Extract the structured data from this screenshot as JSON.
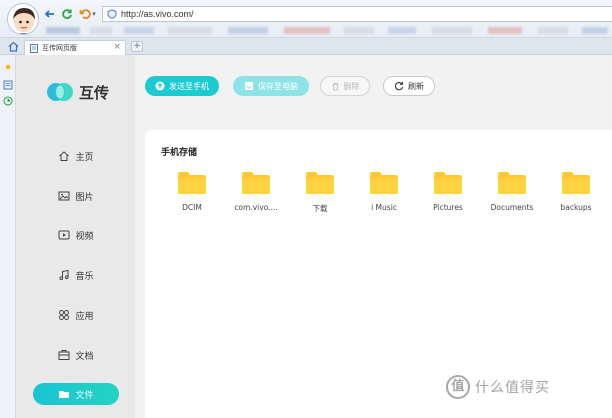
{
  "browser": {
    "url": "http://as.vivo.com/",
    "tab_title": "互传网页版",
    "tab_close": "×",
    "new_tab": "+"
  },
  "app": {
    "logo_text": "互传",
    "nav": [
      {
        "label": "主页",
        "icon": "home-icon"
      },
      {
        "label": "图片",
        "icon": "image-icon"
      },
      {
        "label": "视频",
        "icon": "video-icon"
      },
      {
        "label": "音乐",
        "icon": "music-icon"
      },
      {
        "label": "应用",
        "icon": "apps-icon"
      },
      {
        "label": "文档",
        "icon": "document-icon"
      },
      {
        "label": "文件",
        "icon": "folder-icon",
        "active": true
      }
    ],
    "toolbar": {
      "send_label": "发送至手机",
      "save_label": "保存至电脑",
      "delete_label": "删除",
      "refresh_label": "刷新"
    },
    "storage": {
      "title": "手机存储",
      "folders": [
        "DCIM",
        "com.vivo....",
        "下载",
        "i Music",
        "Pictures",
        "Documents",
        "backups"
      ]
    },
    "colors": {
      "accent": "#1ccad0",
      "accent_light": "#8fe3e6",
      "folder": "#ffc82c",
      "sidebar_bg": "#e9e9e9"
    }
  },
  "watermark": {
    "mark": "值",
    "text": "什么值得买"
  }
}
